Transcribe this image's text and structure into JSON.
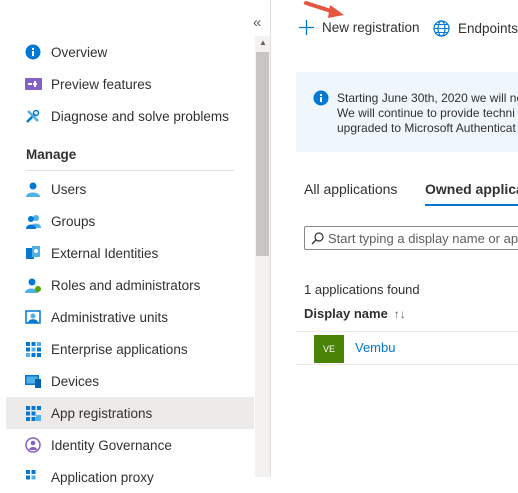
{
  "sidebar": {
    "collapse_glyph": "«",
    "items_top": [
      {
        "label": "Overview",
        "icon": "info-icon"
      },
      {
        "label": "Preview features",
        "icon": "preview-features-icon"
      },
      {
        "label": "Diagnose and solve problems",
        "icon": "wrench-icon"
      }
    ],
    "section_title": "Manage",
    "items_manage": [
      {
        "label": "Users",
        "icon": "user-icon"
      },
      {
        "label": "Groups",
        "icon": "groups-icon"
      },
      {
        "label": "External Identities",
        "icon": "external-identities-icon"
      },
      {
        "label": "Roles and administrators",
        "icon": "roles-icon"
      },
      {
        "label": "Administrative units",
        "icon": "admin-units-icon"
      },
      {
        "label": "Enterprise applications",
        "icon": "enterprise-apps-icon"
      },
      {
        "label": "Devices",
        "icon": "devices-icon"
      },
      {
        "label": "App registrations",
        "icon": "app-registrations-icon",
        "active": true
      },
      {
        "label": "Identity Governance",
        "icon": "identity-governance-icon"
      },
      {
        "label": "Application proxy",
        "icon": "application-proxy-icon"
      }
    ]
  },
  "toolbar": {
    "new_registration": "New registration",
    "endpoints": "Endpoints"
  },
  "info_banner": {
    "line1": "Starting June 30th, 2020 we will no",
    "line2": "We will continue to provide techni",
    "line3": "upgraded to Microsoft Authenticat"
  },
  "tabs": {
    "all": "All applications",
    "owned": "Owned applica"
  },
  "search": {
    "placeholder": "Start typing a display name or ap"
  },
  "results": {
    "count_text": "1 applications found",
    "column_header": "Display name",
    "sort_glyph": "↑↓",
    "rows": [
      {
        "initials": "VE",
        "name": "Vembu"
      }
    ]
  },
  "colors": {
    "accent": "#0078d4",
    "avatar": "#498205",
    "arrow": "#e8553f",
    "banner": "#eff6fc"
  }
}
